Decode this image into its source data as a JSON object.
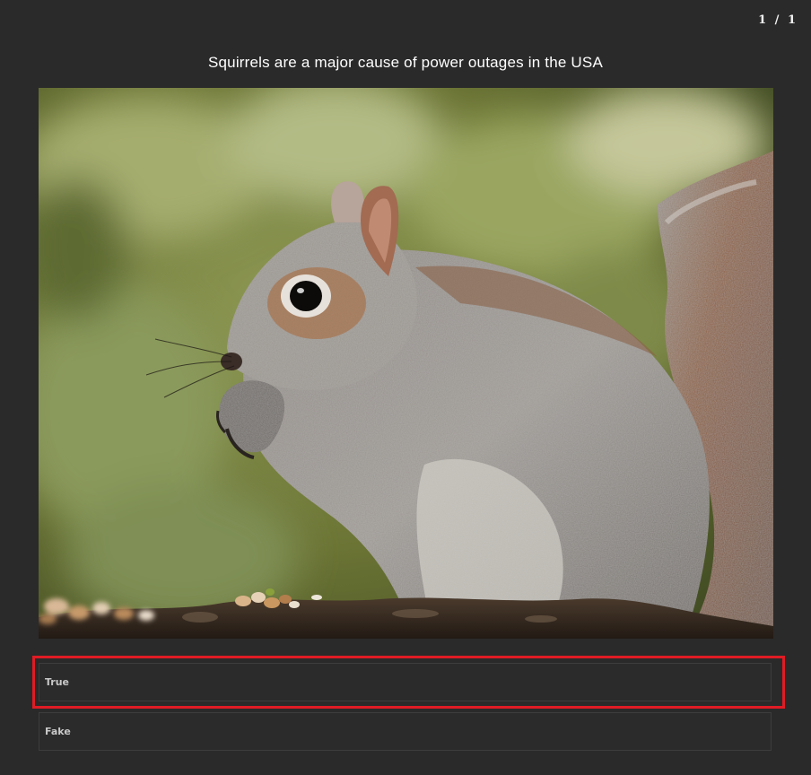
{
  "quiz": {
    "counter": "1 / 1",
    "question": "Squirrels are a major cause of power outages in the USA",
    "image_subject": "grey squirrel eating nuts",
    "answers": [
      {
        "label": "True",
        "highlighted": true
      },
      {
        "label": "Fake",
        "highlighted": false
      }
    ],
    "highlight_color": "#e01b24",
    "background_color": "#2a2a2a"
  }
}
